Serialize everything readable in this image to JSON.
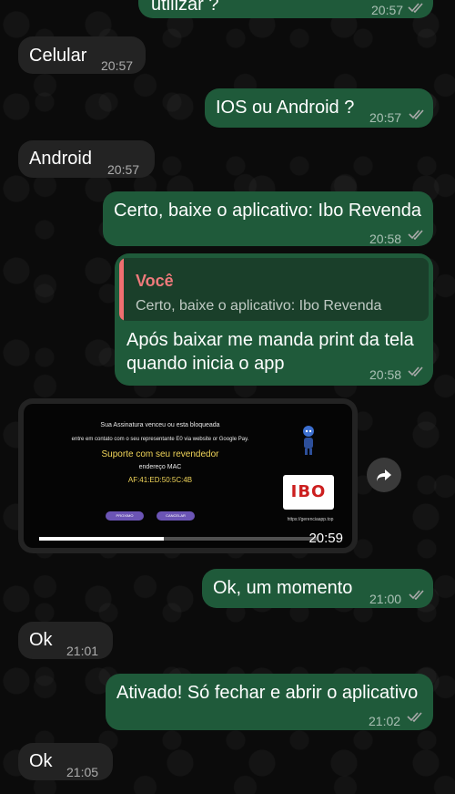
{
  "messages": [
    {
      "text": "utilizar ?",
      "time": "20:57"
    },
    {
      "text": "Celular",
      "time": "20:57"
    },
    {
      "text": "IOS ou Android ?",
      "time": "20:57"
    },
    {
      "text": "Android",
      "time": "20:57"
    },
    {
      "text": "Certo, baixe o aplicativo: Ibo Revenda",
      "time": "20:58"
    },
    {
      "quote_author": "Você",
      "quote_text": "Certo, baixe o aplicativo: Ibo Revenda",
      "text_line1": "Após baixar me manda print da tela",
      "text_line2": "quando inicia o app",
      "time": "20:58"
    },
    {
      "media": {
        "line1": "Sua Assinatura venceu ou esta bloqueada",
        "line2": "entre em contato com o seu representante E0 via website or Google Pay.",
        "highlight": "Suporte com seu revendedor",
        "mac_label": "endereço MAC",
        "mac_value": "AF:41:ED:50:5C:4B",
        "btn1": "PROXIMO",
        "btn2": "CANCELAR",
        "logo_text": "IBO",
        "url": "https://gerenciaapp.top",
        "progress": 0.45
      },
      "time": "20:59"
    },
    {
      "text": "Ok, um momento",
      "time": "21:00"
    },
    {
      "text": "Ok",
      "time": "21:01"
    },
    {
      "text": "Ativado! Só fechar e abrir o aplicativo",
      "time": "21:02"
    },
    {
      "text": "Ok",
      "time": "21:05"
    }
  ],
  "icons": {
    "read_receipt": "double-check-icon",
    "forward": "forward-arrow-icon"
  },
  "colors": {
    "outgoing_bubble": "#1f5a3a",
    "incoming_bubble": "#232323",
    "quote_accent": "#ef6f70",
    "read_ticks": "#aaaaaa"
  }
}
